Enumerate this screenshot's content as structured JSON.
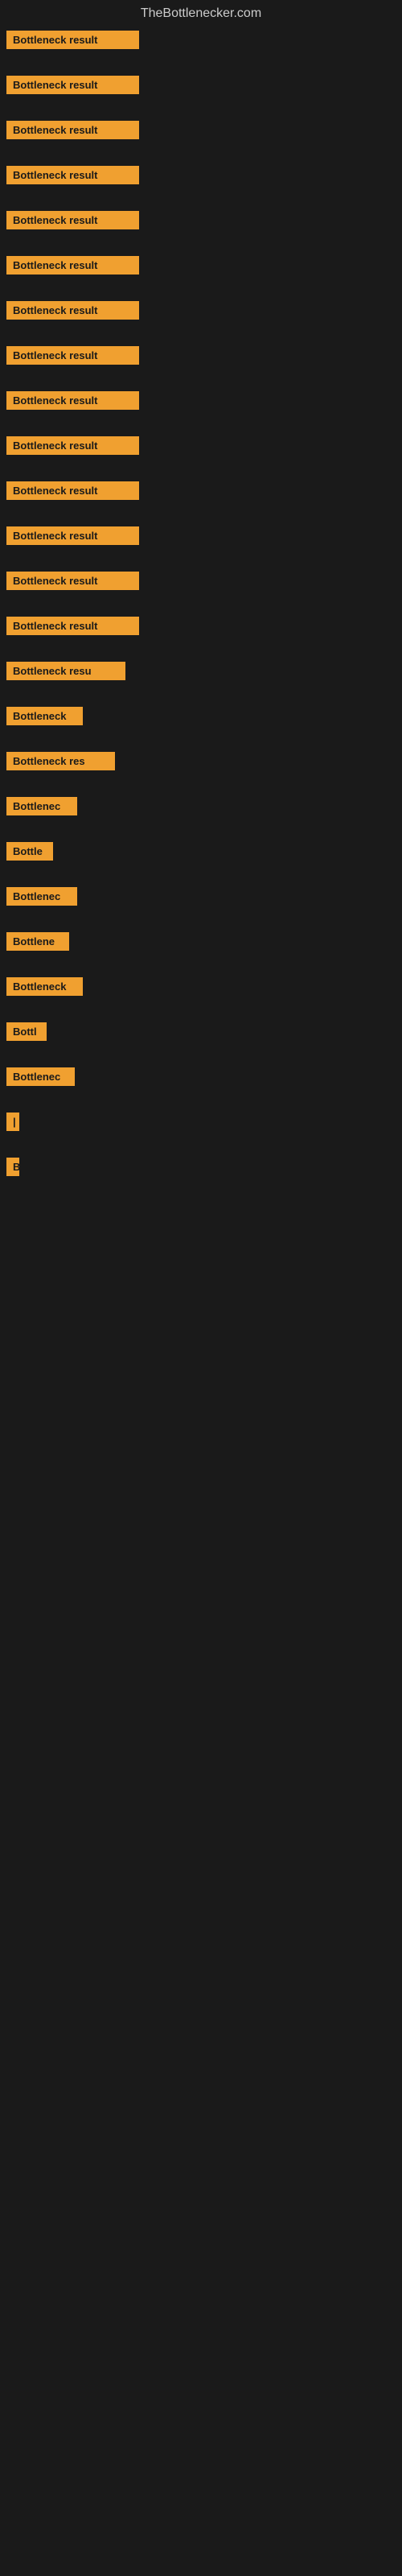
{
  "site": {
    "title": "TheBottlenecker.com"
  },
  "bars": [
    {
      "label": "Bottleneck result",
      "width": 165
    },
    {
      "label": "Bottleneck result",
      "width": 165
    },
    {
      "label": "Bottleneck result",
      "width": 165
    },
    {
      "label": "Bottleneck result",
      "width": 165
    },
    {
      "label": "Bottleneck result",
      "width": 165
    },
    {
      "label": "Bottleneck result",
      "width": 165
    },
    {
      "label": "Bottleneck result",
      "width": 165
    },
    {
      "label": "Bottleneck result",
      "width": 165
    },
    {
      "label": "Bottleneck result",
      "width": 165
    },
    {
      "label": "Bottleneck result",
      "width": 165
    },
    {
      "label": "Bottleneck result",
      "width": 165
    },
    {
      "label": "Bottleneck result",
      "width": 165
    },
    {
      "label": "Bottleneck result",
      "width": 165
    },
    {
      "label": "Bottleneck result",
      "width": 165
    },
    {
      "label": "Bottleneck resu",
      "width": 148
    },
    {
      "label": "Bottleneck",
      "width": 95
    },
    {
      "label": "Bottleneck res",
      "width": 135
    },
    {
      "label": "Bottlenec",
      "width": 88
    },
    {
      "label": "Bottle",
      "width": 58
    },
    {
      "label": "Bottlenec",
      "width": 88
    },
    {
      "label": "Bottlene",
      "width": 78
    },
    {
      "label": "Bottleneck",
      "width": 95
    },
    {
      "label": "Bottl",
      "width": 50
    },
    {
      "label": "Bottlenec",
      "width": 85
    },
    {
      "label": "|",
      "width": 14
    },
    {
      "label": "",
      "width": 0
    },
    {
      "label": "",
      "width": 0
    },
    {
      "label": "",
      "width": 0
    },
    {
      "label": "B",
      "width": 14
    },
    {
      "label": "",
      "width": 0
    },
    {
      "label": "",
      "width": 0
    },
    {
      "label": "",
      "width": 0
    },
    {
      "label": "",
      "width": 0
    },
    {
      "label": "",
      "width": 0
    },
    {
      "label": "",
      "width": 0
    }
  ]
}
